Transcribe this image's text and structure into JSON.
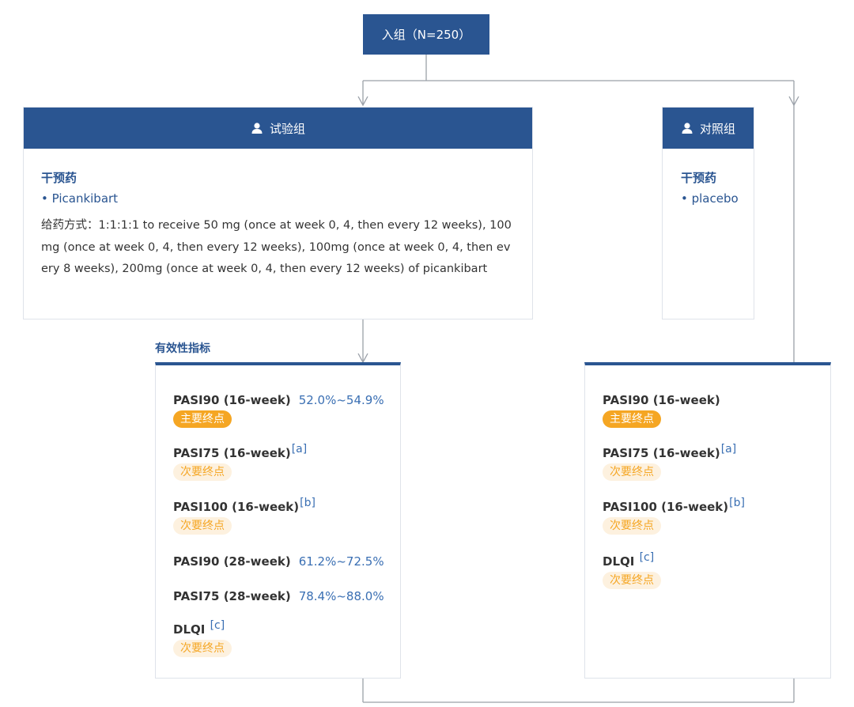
{
  "enrollment": {
    "label": "入组（N=250）"
  },
  "arms": [
    {
      "title": "试验组",
      "intervention_label": "干预药",
      "drug": "• Picankibart",
      "dosing": "给药方式：1:1:1:1 to receive 50 mg (once at week 0, 4, then every 12 weeks), 100mg (once at week 0, 4, then every 12 weeks), 100mg (once at week 0, 4, then every 8 weeks), 200mg (once at week 0, 4, then every 12 weeks) of picankibart"
    },
    {
      "title": "对照组",
      "intervention_label": "干预药",
      "drug": "• placebo"
    }
  ],
  "efficacy_title": "有效性指标",
  "endpoints_treatment": [
    {
      "name": "PASI90 (16-week)",
      "value": "52.0%~54.9%",
      "badge": "主要终点"
    },
    {
      "name": "PASI75 (16-week)",
      "ref": "[a]",
      "badge": "次要终点"
    },
    {
      "name": "PASI100 (16-week)",
      "ref": "[b]",
      "badge": "次要终点"
    },
    {
      "name": "PASI90 (28-week)",
      "value": "61.2%~72.5%"
    },
    {
      "name": "PASI75 (28-week)",
      "value": "78.4%~88.0%"
    },
    {
      "name": "DLQI ",
      "ref": "[c]",
      "badge": "次要终点"
    }
  ],
  "endpoints_control": [
    {
      "name": "PASI90 (16-week)",
      "badge": "主要终点"
    },
    {
      "name": "PASI75 (16-week)",
      "ref": "[a]",
      "badge": "次要终点"
    },
    {
      "name": "PASI100 (16-week)",
      "ref": "[b]",
      "badge": "次要终点"
    },
    {
      "name": "DLQI ",
      "ref": "[c]",
      "badge": "次要终点"
    }
  ],
  "colors": {
    "navy": "#2a5591",
    "primary_badge": "#f5a623",
    "secondary_badge_bg": "#fdf1df",
    "value_blue": "#3a6fb3"
  },
  "icons": [
    "person-icon",
    "arrow-down-icon"
  ]
}
